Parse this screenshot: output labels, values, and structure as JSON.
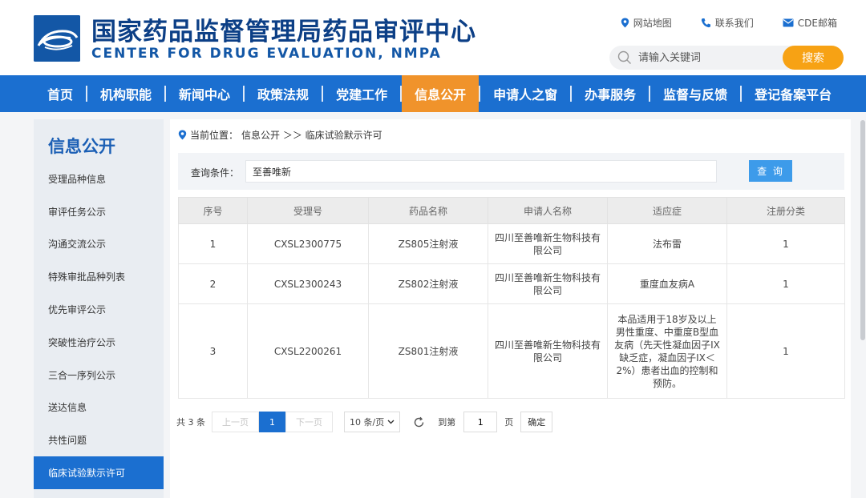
{
  "header": {
    "title_cn": "国家药品监督管理局药品审评中心",
    "title_en": "CENTER FOR DRUG EVALUATION, NMPA",
    "links": [
      {
        "label": "网站地图",
        "icon": "location-pin-icon"
      },
      {
        "label": "联系我们",
        "icon": "phone-icon"
      },
      {
        "label": "CDE邮箱",
        "icon": "mail-icon"
      }
    ],
    "search_placeholder": "请输入关键词",
    "search_button": "搜索"
  },
  "nav": {
    "items": [
      "首页",
      "机构职能",
      "新闻中心",
      "政策法规",
      "党建工作",
      "信息公开",
      "申请人之窗",
      "办事服务",
      "监督与反馈",
      "登记备案平台"
    ],
    "active_index": 5
  },
  "sidebar": {
    "title": "信息公开",
    "items": [
      "受理品种信息",
      "审评任务公示",
      "沟通交流公示",
      "特殊审批品种列表",
      "优先审评公示",
      "突破性治疗公示",
      "三合一序列公示",
      "送达信息",
      "共性问题",
      "临床试验默示许可"
    ],
    "active_index": 9
  },
  "breadcrumb": {
    "prefix": "当前位置：",
    "path": "信息公开 ＞＞ 临床试验默示许可"
  },
  "query": {
    "label": "查询条件：",
    "value": "至善唯新",
    "button": "查 询"
  },
  "table": {
    "headers": [
      "序号",
      "受理号",
      "药品名称",
      "申请人名称",
      "适应症",
      "注册分类"
    ],
    "rows": [
      [
        "1",
        "CXSL2300775",
        "ZS805注射液",
        "四川至善唯新生物科技有限公司",
        "法布雷",
        "1"
      ],
      [
        "2",
        "CXSL2300243",
        "ZS802注射液",
        "四川至善唯新生物科技有限公司",
        "重度血友病A",
        "1"
      ],
      [
        "3",
        "CXSL2200261",
        "ZS801注射液",
        "四川至善唯新生物科技有限公司",
        "本品适用于18岁及以上男性重度、中重度B型血友病（先天性凝血因子IX缺乏症，凝血因子IX＜2%）患者出血的控制和预防。",
        "1"
      ]
    ]
  },
  "pagination": {
    "total": "共 3 条",
    "prev": "上一页",
    "current_page": "1",
    "next": "下一页",
    "page_size": "10 条/页",
    "goto_label": "到第",
    "goto_value": "1",
    "page_label": "页",
    "confirm": "确定"
  },
  "colors": {
    "brand_blue": "#1b6fd0",
    "nav_active": "#f0932b",
    "search_button": "#f7a214",
    "query_button": "#3d9bea"
  }
}
